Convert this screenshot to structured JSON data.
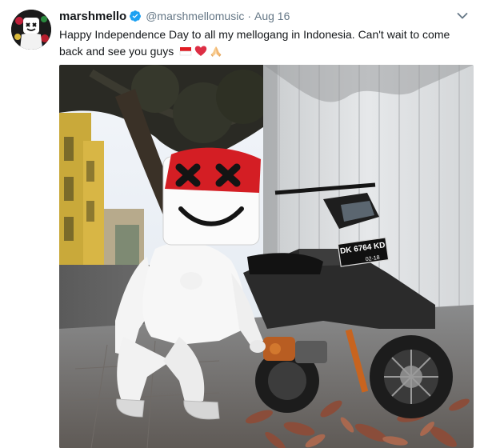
{
  "tweet": {
    "author_name": "marshmello",
    "handle": "@marshmellomusic",
    "separator": "·",
    "date": "Aug 16",
    "text": "Happy Independence Day to all my mellogang in Indonesia. Can't wait to come back and see you guys",
    "emojis": [
      "indonesia-flag",
      "red-heart",
      "folded-hands"
    ],
    "photo": {
      "plate_text": "DK 6764 KD",
      "plate_subtext": "02-18"
    }
  },
  "colors": {
    "name": "#14171a",
    "secondary": "#657786",
    "verified": "#1da1f2",
    "helmet_red": "#d41e24"
  },
  "icons": [
    "verified-badge-icon",
    "chevron-down-icon"
  ]
}
